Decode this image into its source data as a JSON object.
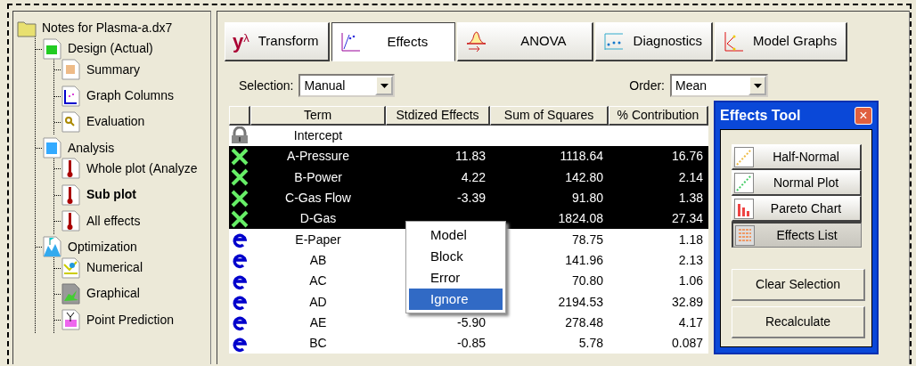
{
  "tree": {
    "label": "Notes for Plasma-a.dx7",
    "kind": "folder",
    "children": [
      {
        "label": "Design (Actual)",
        "kind": "design",
        "selected": false,
        "children": [
          {
            "label": "Summary",
            "kind": "summary",
            "selected": false
          },
          {
            "label": "Graph Columns",
            "kind": "graph",
            "selected": false
          },
          {
            "label": "Evaluation",
            "kind": "evaluation",
            "selected": false
          }
        ]
      },
      {
        "label": "Analysis",
        "kind": "analysis",
        "selected": false,
        "children": [
          {
            "label": "Whole plot (Analyze",
            "kind": "thermo",
            "selected": false
          },
          {
            "label": "Sub plot",
            "kind": "thermo",
            "selected": true
          },
          {
            "label": "All effects",
            "kind": "thermo",
            "selected": false
          }
        ]
      },
      {
        "label": "Optimization",
        "kind": "optimization",
        "selected": false,
        "children": [
          {
            "label": "Numerical",
            "kind": "numerical",
            "selected": false
          },
          {
            "label": "Graphical",
            "kind": "graphical",
            "selected": false
          },
          {
            "label": "Point Prediction",
            "kind": "prediction",
            "selected": false
          }
        ]
      }
    ]
  },
  "tabs": [
    {
      "label": "Transform",
      "kind": "transform",
      "selected": false,
      "symbol": "y",
      "symbol_sup": "λ"
    },
    {
      "label": "Effects",
      "kind": "effects",
      "selected": true
    },
    {
      "label": "ANOVA",
      "kind": "anova",
      "selected": false
    },
    {
      "label": "Diagnostics",
      "kind": "diagnostics",
      "selected": false
    },
    {
      "label": "Model Graphs",
      "kind": "modelgraphs",
      "selected": false
    }
  ],
  "selection": {
    "label": "Selection:",
    "value": "Manual"
  },
  "order": {
    "label": "Order:",
    "value": "Mean"
  },
  "table": {
    "columns": [
      "Term",
      "Stdized Effects",
      "Sum of Squares",
      "% Contribution"
    ],
    "rows": [
      {
        "kind": "intercept",
        "selected": false,
        "cells": [
          "Intercept",
          "",
          "",
          ""
        ]
      },
      {
        "kind": "model",
        "selected": true,
        "cells": [
          "A-Pressure",
          "11.83",
          "1118.64",
          "16.76"
        ]
      },
      {
        "kind": "model",
        "selected": true,
        "cells": [
          "B-Power",
          "4.22",
          "142.80",
          "2.14"
        ]
      },
      {
        "kind": "model",
        "selected": true,
        "cells": [
          "C-Gas Flow",
          "-3.39",
          "91.80",
          "1.38"
        ]
      },
      {
        "kind": "model",
        "selected": true,
        "cells": [
          "D-Gas",
          "",
          "1824.08",
          "27.34"
        ]
      },
      {
        "kind": "error",
        "selected": false,
        "cells": [
          "E-Paper",
          "",
          "78.75",
          "1.18"
        ]
      },
      {
        "kind": "error",
        "selected": false,
        "cells": [
          "AB",
          "",
          "141.96",
          "2.13"
        ]
      },
      {
        "kind": "error",
        "selected": false,
        "cells": [
          "AC",
          "",
          "70.80",
          "1.06"
        ]
      },
      {
        "kind": "error",
        "selected": false,
        "cells": [
          "AD",
          "",
          "2194.53",
          "32.89"
        ]
      },
      {
        "kind": "error",
        "selected": false,
        "cells": [
          "AE",
          "-5.90",
          "278.48",
          "4.17"
        ]
      },
      {
        "kind": "error",
        "selected": false,
        "cells": [
          "BC",
          "-0.85",
          "5.78",
          "0.087"
        ]
      }
    ]
  },
  "context_menu": [
    {
      "label": "Model",
      "selected": false
    },
    {
      "label": "Block",
      "selected": false
    },
    {
      "label": "Error",
      "selected": false
    },
    {
      "label": "Ignore",
      "selected": true
    }
  ],
  "effects_tool": {
    "title": "Effects Tool",
    "close": "×",
    "views": [
      {
        "label": "Half-Normal",
        "kind": "halfnormal",
        "selected": false
      },
      {
        "label": "Normal Plot",
        "kind": "normal",
        "selected": false
      },
      {
        "label": "Pareto Chart",
        "kind": "pareto",
        "selected": false
      },
      {
        "label": "Effects List",
        "kind": "list",
        "selected": true
      }
    ],
    "buttons": [
      "Clear Selection",
      "Recalculate"
    ]
  }
}
